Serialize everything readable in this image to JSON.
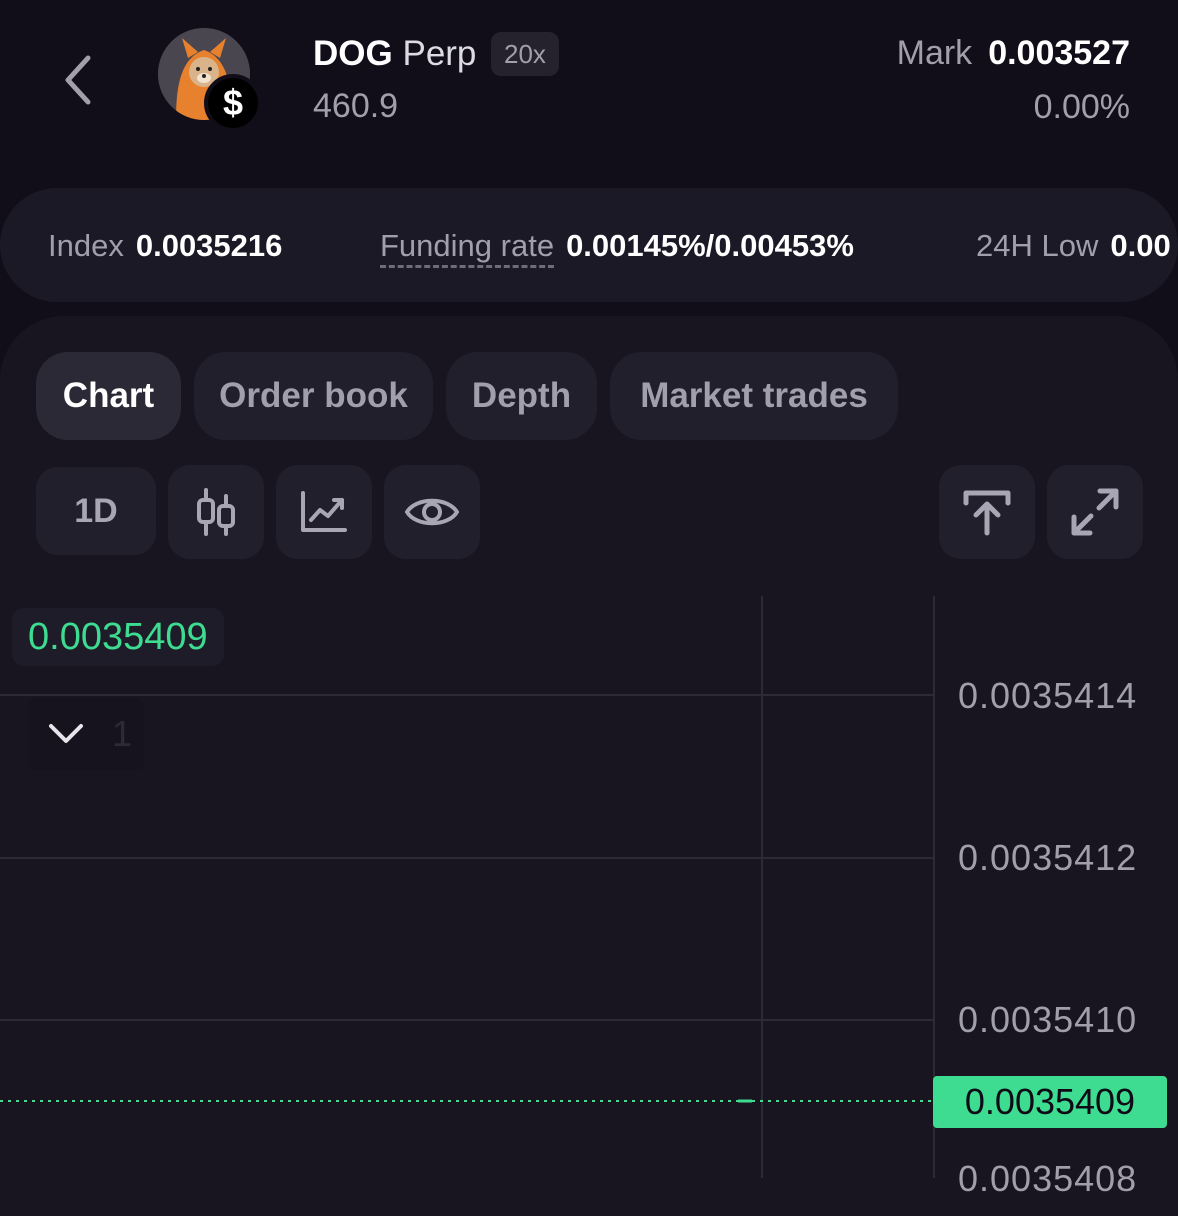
{
  "header": {
    "symbol": "DOG",
    "type": "Perp",
    "leverage": "20x",
    "sub_value": "460.9",
    "mark_label": "Mark",
    "mark_value": "0.003527",
    "change": "0.00%"
  },
  "stats": [
    {
      "label": "Index",
      "value": "0.0035216"
    },
    {
      "label": "Funding rate",
      "value": "0.00145%/0.00453%"
    },
    {
      "label": "24H Low",
      "value": "0.00"
    }
  ],
  "tabs": [
    "Chart",
    "Order book",
    "Depth",
    "Market trades"
  ],
  "toolbar": {
    "timeframe": "1D",
    "icons": [
      "candlestick-icon",
      "line-chart-icon",
      "eye-icon",
      "upload-icon",
      "expand-icon"
    ]
  },
  "chart": {
    "current_price": "0.0035409",
    "indicator_count": "1",
    "y_ticks": [
      "0.0035414",
      "0.0035412",
      "0.0035410",
      "0.0035408"
    ],
    "price_tag": "0.0035409",
    "colors": {
      "up": "#3ddc91",
      "background": "#181521"
    }
  }
}
